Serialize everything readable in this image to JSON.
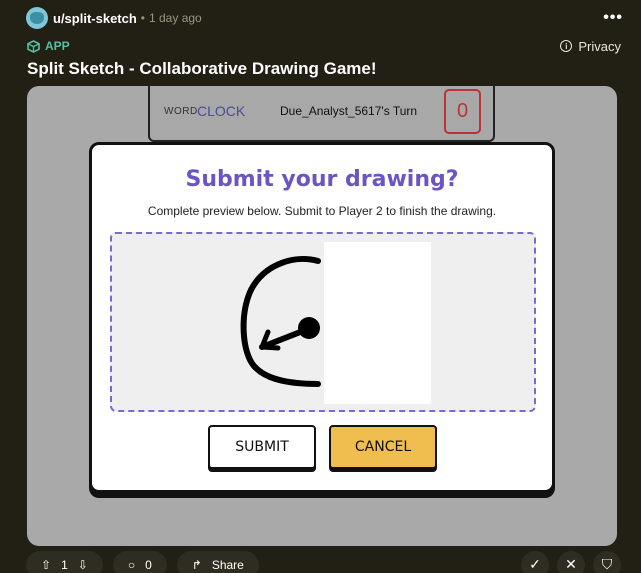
{
  "post": {
    "author": "u/split-sketch",
    "separator": "•",
    "time": "1 day ago",
    "more_label": "•••",
    "app_label": "APP",
    "privacy_label": "Privacy",
    "title": "Split Sketch - Collaborative Drawing Game!"
  },
  "game": {
    "word_label": "WORD:",
    "word": "CLOCK",
    "turn": "Due_Analyst_5617's Turn",
    "score": "0"
  },
  "modal": {
    "title": "Submit your drawing?",
    "subtitle": "Complete preview below. Submit to Player 2 to finish the drawing.",
    "submit_label": "SUBMIT",
    "cancel_label": "CANCEL"
  },
  "footer": {
    "upvotes": "1",
    "comments": "0",
    "share_label": "Share"
  },
  "colors": {
    "accent_purple": "#6a55c4",
    "cancel_yellow": "#f0bd4f",
    "app_green": "#52c1a3",
    "score_red": "#b33333"
  }
}
